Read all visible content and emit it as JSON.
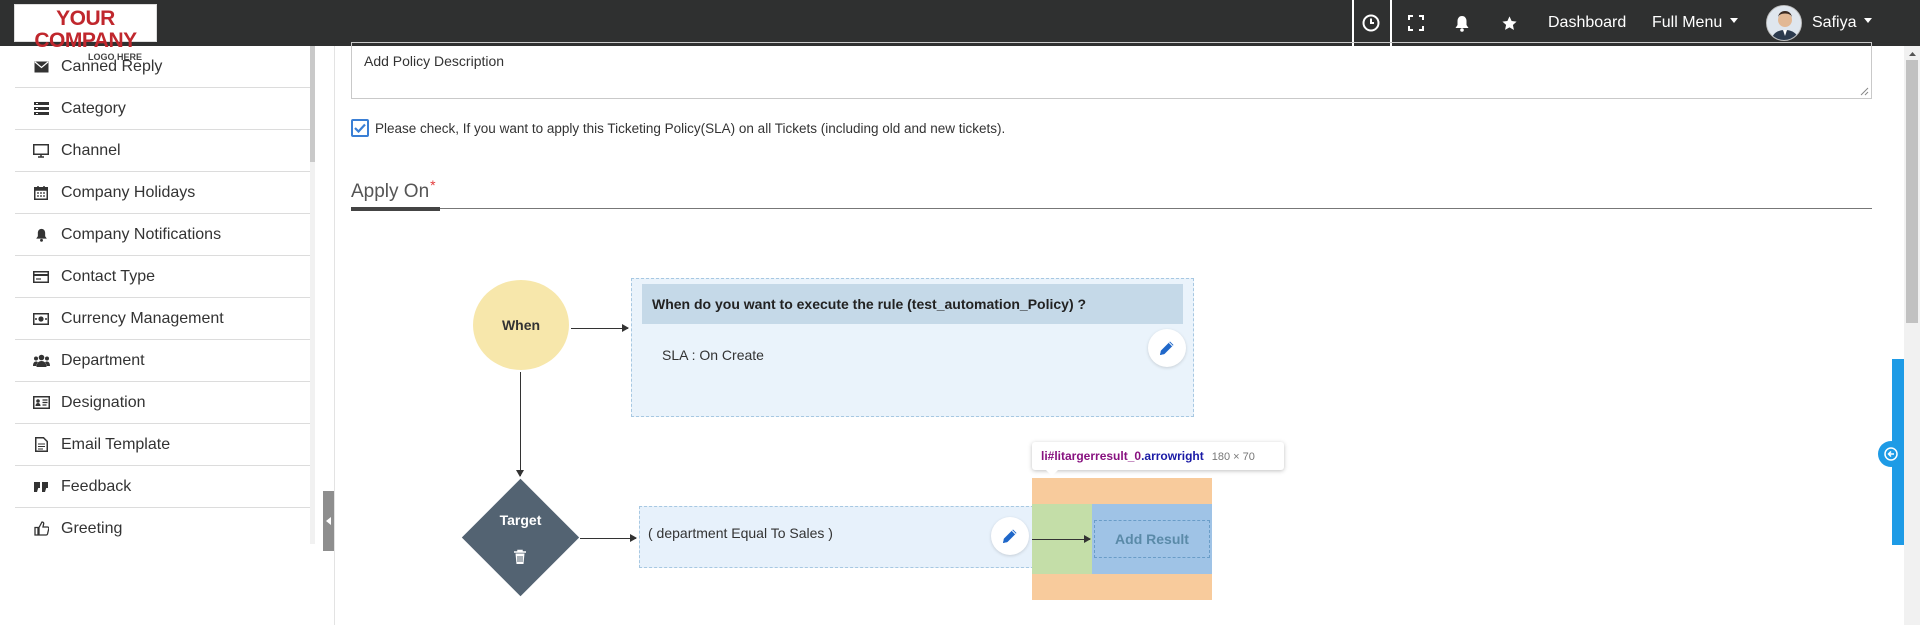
{
  "header": {
    "logo_line1": "YOUR COMPANY",
    "logo_line2": "LOGO HERE",
    "dashboard_label": "Dashboard",
    "full_menu_label": "Full Menu",
    "user_name": "Safiya",
    "icons": [
      "clock-icon",
      "fullscreen-icon",
      "bell-icon",
      "star-icon"
    ]
  },
  "sidebar": {
    "items": [
      {
        "label": "Canned Reply",
        "icon": "envelope-icon"
      },
      {
        "label": "Category",
        "icon": "list-icon"
      },
      {
        "label": "Channel",
        "icon": "monitor-icon"
      },
      {
        "label": "Company Holidays",
        "icon": "calendar-icon"
      },
      {
        "label": "Company Notifications",
        "icon": "bell-icon"
      },
      {
        "label": "Contact Type",
        "icon": "card-icon"
      },
      {
        "label": "Currency Management",
        "icon": "money-icon"
      },
      {
        "label": "Department",
        "icon": "users-icon"
      },
      {
        "label": "Designation",
        "icon": "id-card-icon"
      },
      {
        "label": "Email Template",
        "icon": "file-icon"
      },
      {
        "label": "Feedback",
        "icon": "quote-icon"
      },
      {
        "label": "Greeting",
        "icon": "thumbs-up-icon"
      }
    ]
  },
  "form": {
    "description_placeholder": "Add Policy Description",
    "apply_all_label": "Please check, If you want to apply this Ticketing Policy(SLA) on all Tickets (including old and new tickets).",
    "apply_all_checked": true,
    "apply_on_title": "Apply On",
    "required_mark": "*"
  },
  "diagram": {
    "when_label": "When",
    "when_question": "When do you want to execute the rule (test_automation_Policy) ?",
    "when_value": "SLA : On Create",
    "target_label": "Target",
    "condition": "( department Equal To Sales )",
    "add_result_label": "Add Result"
  },
  "devtools_tooltip": {
    "selector": "li#litargerresult_0",
    "class": ".arrowright",
    "dimensions": "180 × 70"
  },
  "colors": {
    "topbar": "#2f3030",
    "accent_blue": "#1e9be6",
    "when_circle": "#f7e7ab",
    "target_diamond": "#536372"
  }
}
